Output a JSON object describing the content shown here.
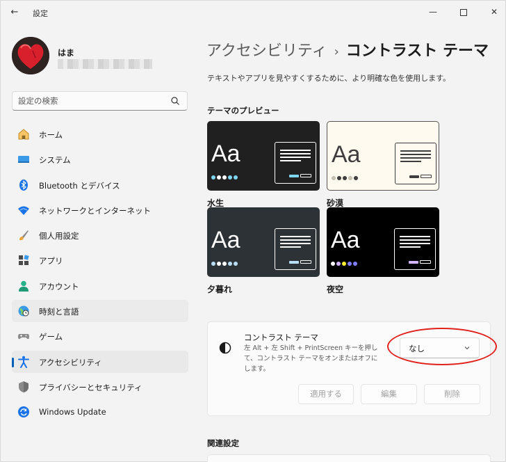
{
  "window": {
    "app_title": "設定",
    "back_glyph": "←",
    "minimize_glyph": "—",
    "close_glyph": "✕"
  },
  "profile": {
    "name": "はま"
  },
  "search": {
    "placeholder": "設定の検索"
  },
  "nav": {
    "items": [
      {
        "label": "ホーム",
        "icon": "home-icon"
      },
      {
        "label": "システム",
        "icon": "system-icon"
      },
      {
        "label": "Bluetooth とデバイス",
        "icon": "bluetooth-icon"
      },
      {
        "label": "ネットワークとインターネット",
        "icon": "wifi-icon"
      },
      {
        "label": "個人用設定",
        "icon": "brush-icon"
      },
      {
        "label": "アプリ",
        "icon": "apps-icon"
      },
      {
        "label": "アカウント",
        "icon": "account-icon"
      },
      {
        "label": "時刻と言語",
        "icon": "time-language-icon"
      },
      {
        "label": "ゲーム",
        "icon": "gamepad-icon"
      },
      {
        "label": "アクセシビリティ",
        "icon": "accessibility-icon"
      },
      {
        "label": "プライバシーとセキュリティ",
        "icon": "shield-icon"
      },
      {
        "label": "Windows Update",
        "icon": "update-icon"
      }
    ],
    "selected_index": 9
  },
  "main": {
    "breadcrumb_parent": "アクセシビリティ",
    "breadcrumb_sep": "›",
    "breadcrumb_current": "コントラスト テーマ",
    "description": "テキストやアプリを見やすくするために、より明確な色を使用します。",
    "preview_heading": "テーマのプレビュー",
    "themes": [
      {
        "name": "水生",
        "sample": "Aa",
        "bg": "#202020",
        "fg": "#ffffff",
        "dots": [
          "#7fd6f2",
          "#ffffff",
          "#ffffff",
          "#7fd6f2",
          "#7fd6f2"
        ],
        "accent": "#7fd6f2"
      },
      {
        "name": "砂漠",
        "sample": "Aa",
        "bg": "#fffaef",
        "fg": "#3d3d3d",
        "dots": [
          "#c6c0b3",
          "#3d3d3d",
          "#3d3d3d",
          "#c6c0b3",
          "#3d3d3d"
        ],
        "accent": "#3d3d3d"
      },
      {
        "name": "夕暮れ",
        "sample": "Aa",
        "bg": "#2d3236",
        "fg": "#ffffff",
        "dots": [
          "#b8dff6",
          "#ffffff",
          "#ffffff",
          "#b8dff6",
          "#b8dff6"
        ],
        "accent": "#b8dff6"
      },
      {
        "name": "夜空",
        "sample": "Aa",
        "bg": "#000000",
        "fg": "#ffffff",
        "dots": [
          "#ffffff",
          "#d6b4fd",
          "#ffee32",
          "#8080ff",
          "#8080ff"
        ],
        "accent": "#d6b4fd"
      }
    ],
    "contrast": {
      "title": "コントラスト テーマ",
      "description": "左 Alt + 左 Shift + PrintScreen キーを押して、コントラスト テーマをオンまたはオフにします。",
      "dropdown_value": "なし",
      "apply_label": "適用する",
      "edit_label": "編集",
      "delete_label": "削除"
    },
    "related_heading": "関連設定"
  },
  "colors": {
    "accent": "#005fb8",
    "annotation": "#e0211d"
  }
}
